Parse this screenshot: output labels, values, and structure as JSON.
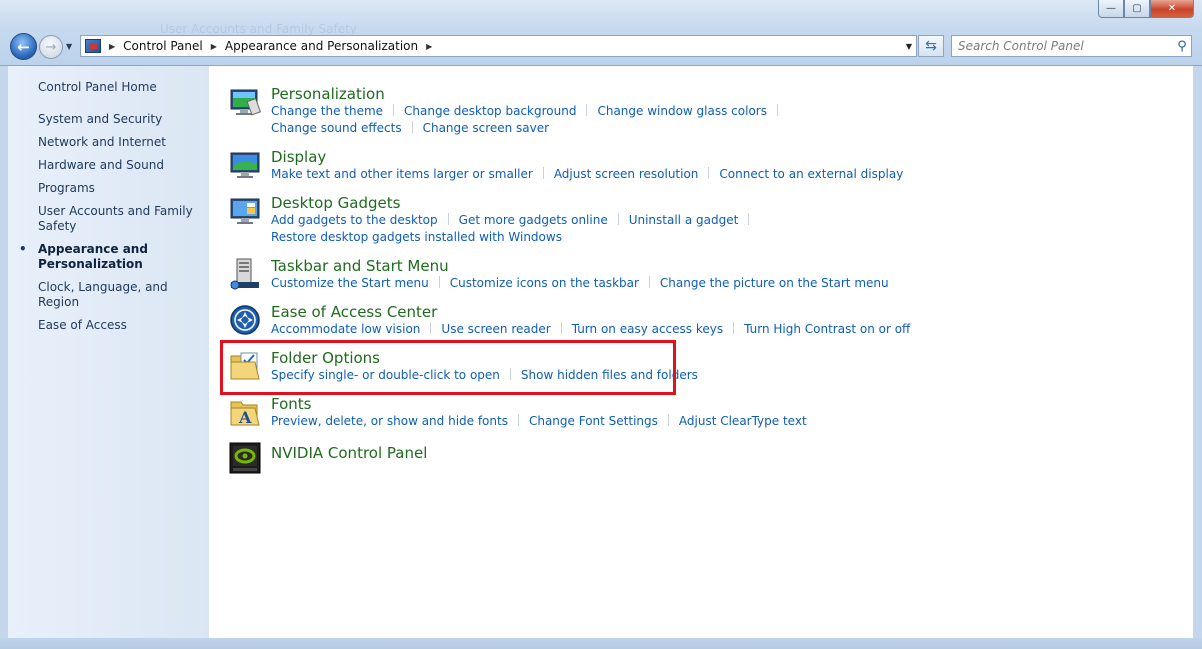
{
  "window": {
    "ghost_title": "User Accounts and Family Safety",
    "minimize": "—",
    "maximize": "▢",
    "close": "✕"
  },
  "address": {
    "crumbs": [
      "Control Panel",
      "Appearance and Personalization"
    ]
  },
  "search": {
    "placeholder": "Search Control Panel"
  },
  "sidebar": {
    "home": "Control Panel Home",
    "items": [
      {
        "label": "System and Security"
      },
      {
        "label": "Network and Internet"
      },
      {
        "label": "Hardware and Sound"
      },
      {
        "label": "Programs"
      },
      {
        "label": "User Accounts and Family Safety"
      },
      {
        "label": "Appearance and Personalization",
        "active": true
      },
      {
        "label": "Clock, Language, and Region"
      },
      {
        "label": "Ease of Access"
      }
    ]
  },
  "categories": [
    {
      "title": "Personalization",
      "icon": "personalization-icon",
      "links": [
        [
          "Change the theme",
          "Change desktop background",
          "Change window glass colors"
        ],
        [
          "Change sound effects",
          "Change screen saver"
        ]
      ]
    },
    {
      "title": "Display",
      "icon": "display-icon",
      "links": [
        [
          "Make text and other items larger or smaller",
          "Adjust screen resolution",
          "Connect to an external display"
        ]
      ]
    },
    {
      "title": "Desktop Gadgets",
      "icon": "gadgets-icon",
      "links": [
        [
          "Add gadgets to the desktop",
          "Get more gadgets online",
          "Uninstall a gadget"
        ],
        [
          "Restore desktop gadgets installed with Windows"
        ]
      ]
    },
    {
      "title": "Taskbar and Start Menu",
      "icon": "taskbar-icon",
      "links": [
        [
          "Customize the Start menu",
          "Customize icons on the taskbar",
          "Change the picture on the Start menu"
        ]
      ]
    },
    {
      "title": "Ease of Access Center",
      "icon": "ease-of-access-icon",
      "links": [
        [
          "Accommodate low vision",
          "Use screen reader",
          "Turn on easy access keys",
          "Turn High Contrast on or off"
        ]
      ]
    },
    {
      "title": "Folder Options",
      "icon": "folder-options-icon",
      "links": [
        [
          "Specify single- or double-click to open",
          "Show hidden files and folders"
        ]
      ]
    },
    {
      "title": "Fonts",
      "icon": "fonts-icon",
      "links": [
        [
          "Preview, delete, or show and hide fonts",
          "Change Font Settings",
          "Adjust ClearType text"
        ]
      ]
    },
    {
      "title": "NVIDIA Control Panel",
      "icon": "nvidia-icon",
      "links": []
    }
  ],
  "colors": {
    "category_title": "#1e6b1e",
    "link": "#0e5db6",
    "highlight_box": "#e0101f"
  }
}
